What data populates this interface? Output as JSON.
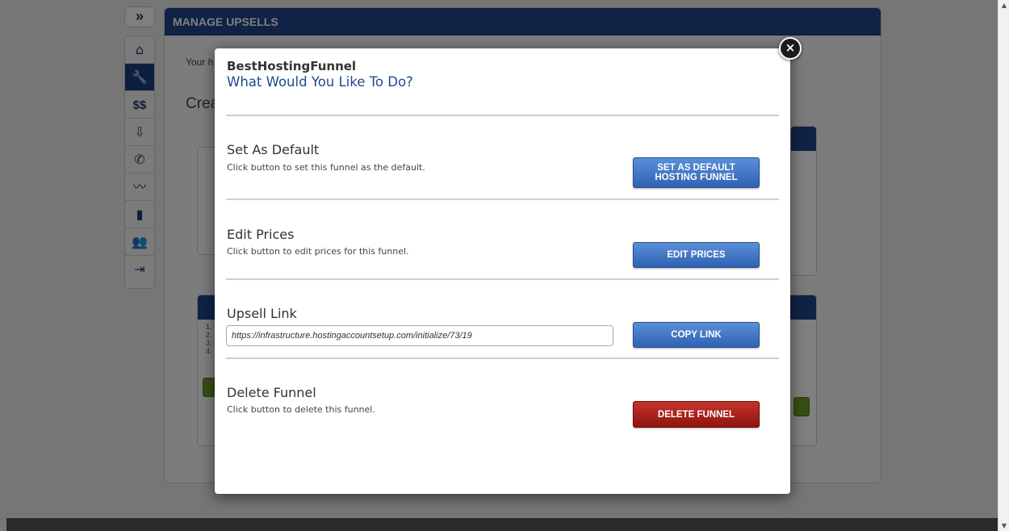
{
  "background": {
    "toggle_icon": "»",
    "nav_items": [
      {
        "name": "home-icon",
        "glyph": "⌂"
      },
      {
        "name": "wrench-icon",
        "glyph": "🔧"
      },
      {
        "name": "money-icon",
        "glyph": "$$"
      },
      {
        "name": "inbox-download-icon",
        "glyph": "⇩"
      },
      {
        "name": "phone-icon",
        "glyph": "✆"
      },
      {
        "name": "trend-chart-icon",
        "glyph": "〰"
      },
      {
        "name": "bar-chart-icon",
        "glyph": "▮"
      },
      {
        "name": "users-icon",
        "glyph": "👥"
      },
      {
        "name": "logout-icon",
        "glyph": "⇥"
      }
    ],
    "panel_title": "MANAGE UPSELLS",
    "intro_text": "Your h",
    "create_text": "Crea",
    "list_numbers": [
      "1.",
      "2.",
      "3.",
      "4."
    ]
  },
  "modal": {
    "close_icon": "×",
    "funnel_name": "BestHostingFunnel",
    "title": "What Would You Like To Do?",
    "sections": {
      "set_default": {
        "title": "Set As Default",
        "description": "Click button to set this funnel as the default.",
        "button_line1": "SET AS DEFAULT",
        "button_line2": "HOSTING FUNNEL"
      },
      "edit_prices": {
        "title": "Edit Prices",
        "description": "Click button to edit prices for this funnel.",
        "button": "EDIT PRICES"
      },
      "upsell_link": {
        "title": "Upsell Link",
        "url": "https://infrastructure.hostingaccountsetup.com/initialize/73/19",
        "button": "COPY LINK"
      },
      "delete_funnel": {
        "title": "Delete Funnel",
        "description": "Click button to delete this funnel.",
        "button": "DELETE FUNNEL"
      }
    }
  }
}
